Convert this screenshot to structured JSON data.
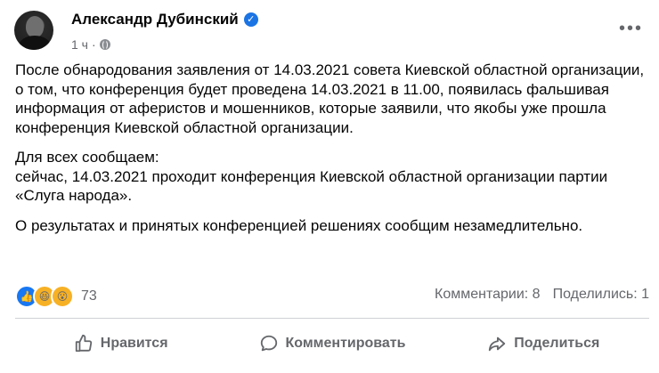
{
  "post": {
    "author": "Александр Дубинский",
    "time": "1 ч",
    "paragraphs": [
      "После обнародования заявления от 14.03.2021 совета Киевской областной организации, о том, что конференция будет проведена 14.03.2021 в 11.00, появилась фальшивая информация от аферистов и мошенников, которые заявили, что якобы уже прошла конференция Киевской областной организации.",
      "Для всех сообщаем:",
      "сейчас, 14.03.2021 проходит конференция Киевской областной организации партии «Слуга народа».",
      "О результатах и принятых конференцией решениях сообщим незамедлительно."
    ]
  },
  "stats": {
    "reaction_count": "73",
    "comments": "Комментарии: 8",
    "shares": "Поделились: 1"
  },
  "actions": {
    "like": "Нравится",
    "comment": "Комментировать",
    "share": "Поделиться"
  },
  "colors": {
    "accent": "#1877f2",
    "secondary_text": "#65676b"
  }
}
